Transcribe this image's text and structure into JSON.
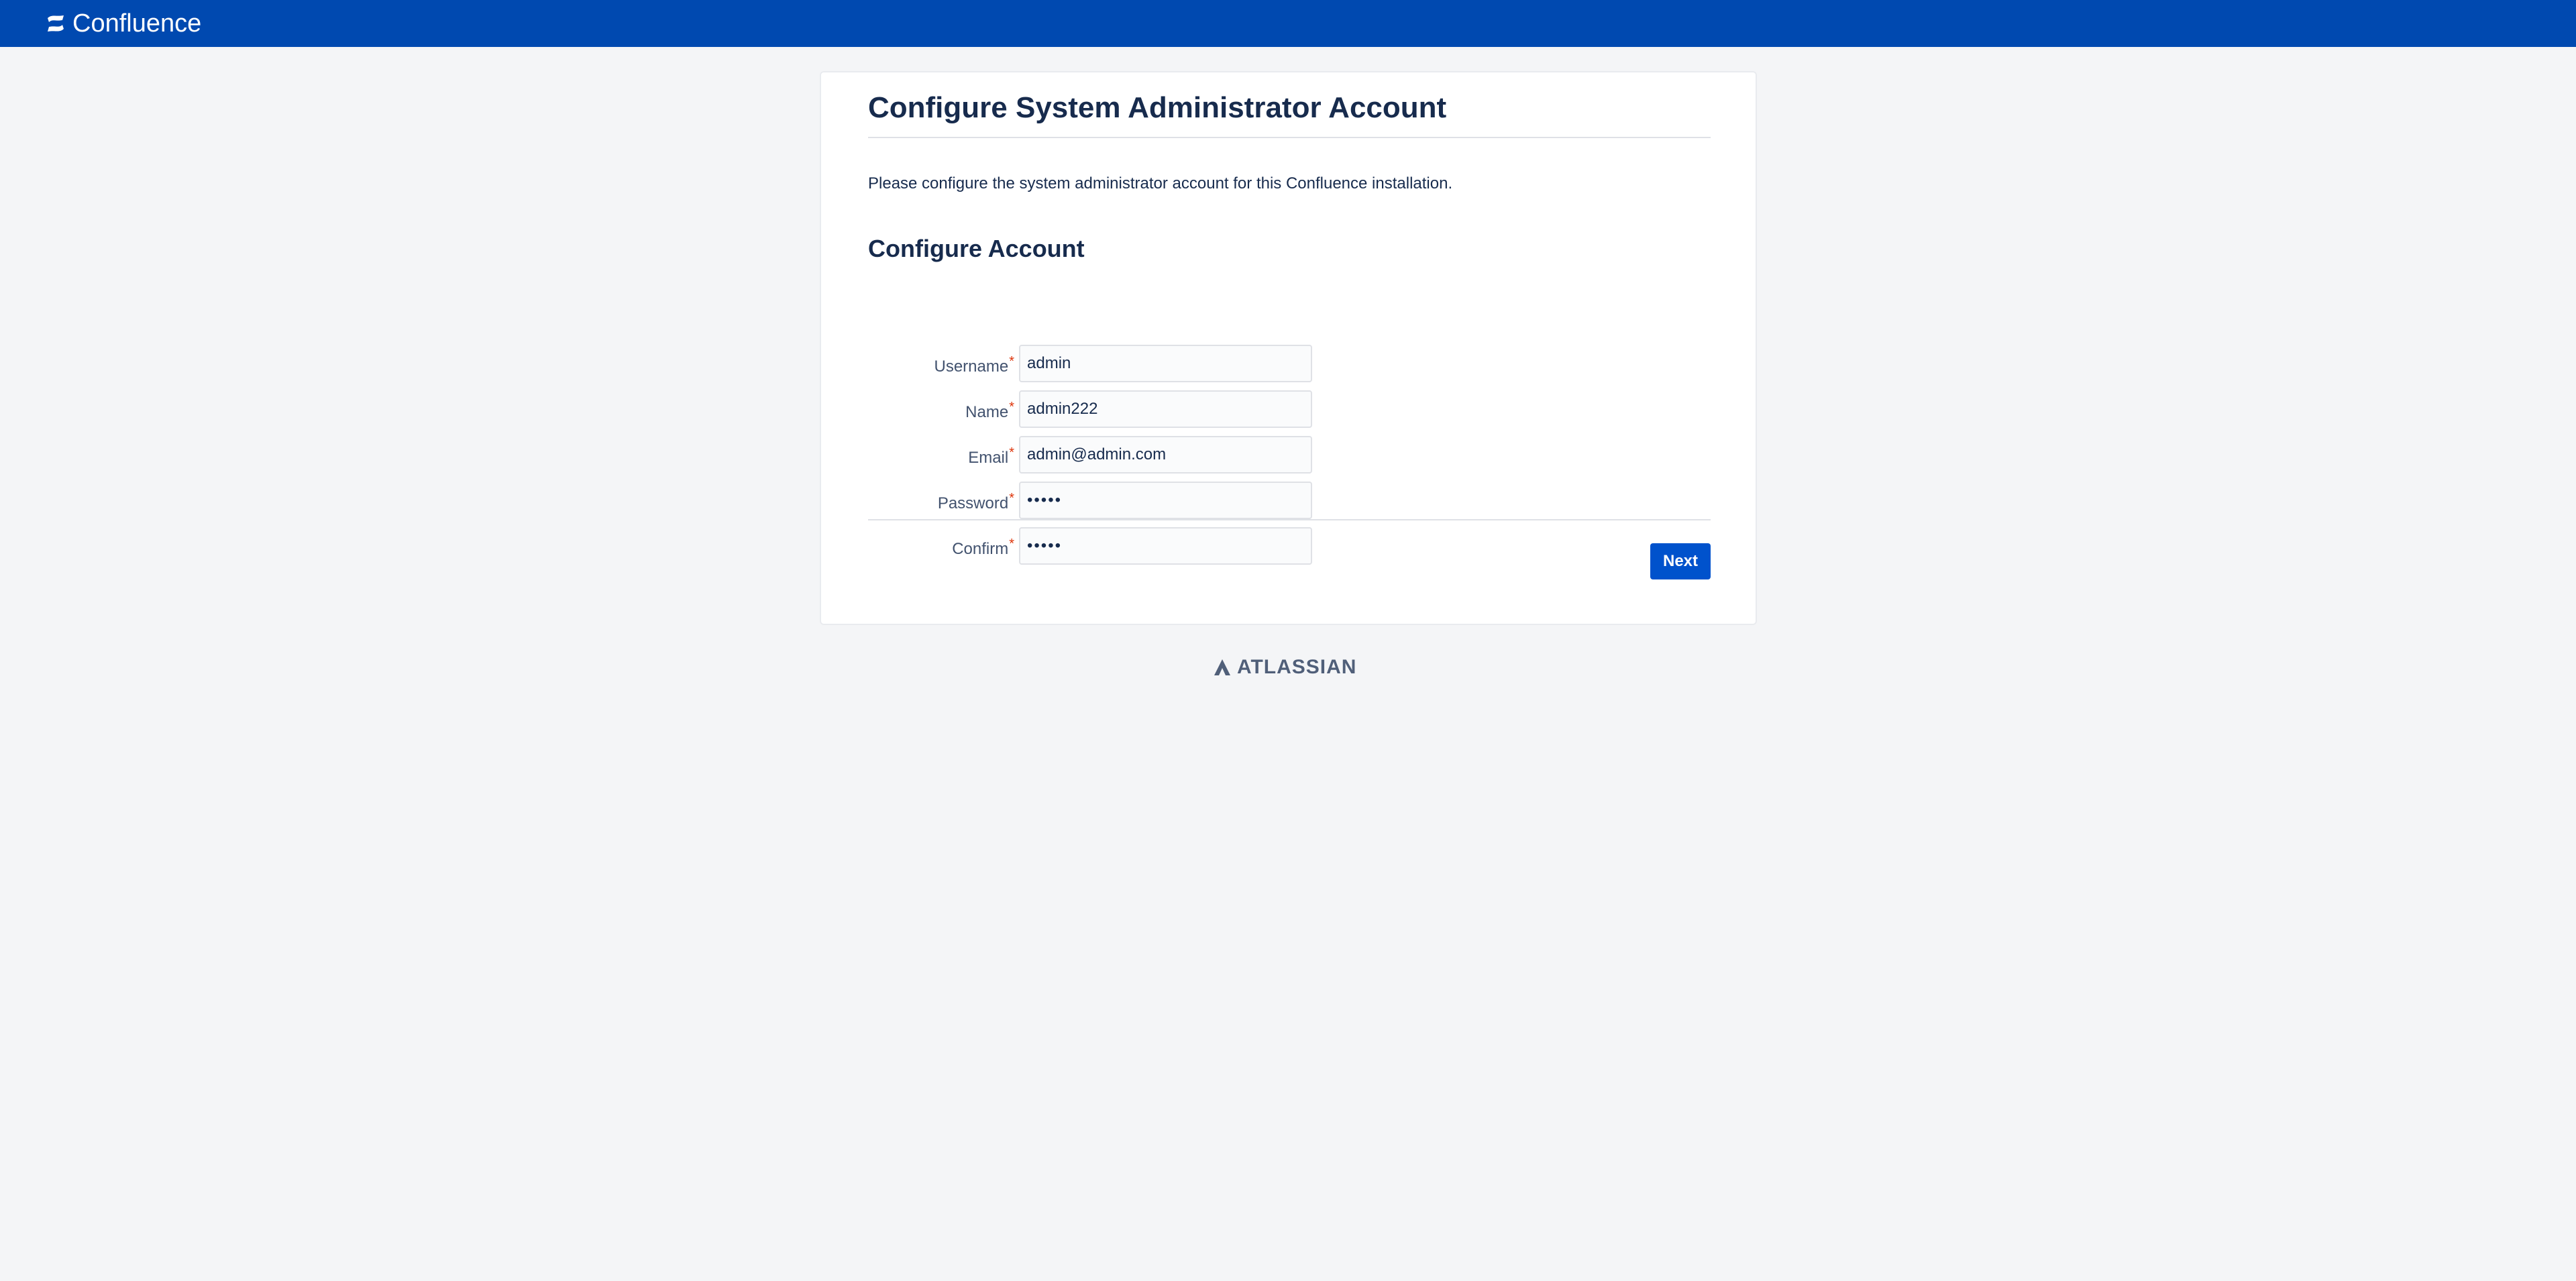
{
  "app": {
    "brand_name": "Confluence",
    "brand_icon": "confluence-logo-icon",
    "topbar_color": "#0049b0"
  },
  "page": {
    "title": "Configure System Administrator Account",
    "intro": "Please configure the system administrator account for this Confluence installation.",
    "section_title": "Configure Account"
  },
  "form": {
    "username": {
      "label": "Username",
      "value": "admin",
      "required_mark": "*"
    },
    "name": {
      "label": "Name",
      "value": "admin222",
      "required_mark": "*"
    },
    "email": {
      "label": "Email",
      "value": "admin@admin.com",
      "required_mark": "*"
    },
    "password": {
      "label": "Password",
      "value": "•••••",
      "required_mark": "*"
    },
    "confirm": {
      "label": "Confirm",
      "value": "•••••",
      "required_mark": "*"
    }
  },
  "actions": {
    "next_label": "Next",
    "next_color": "#0052cc"
  },
  "footer": {
    "logo_text": "ATLASSIAN",
    "logo_icon": "atlassian-logo-icon"
  }
}
